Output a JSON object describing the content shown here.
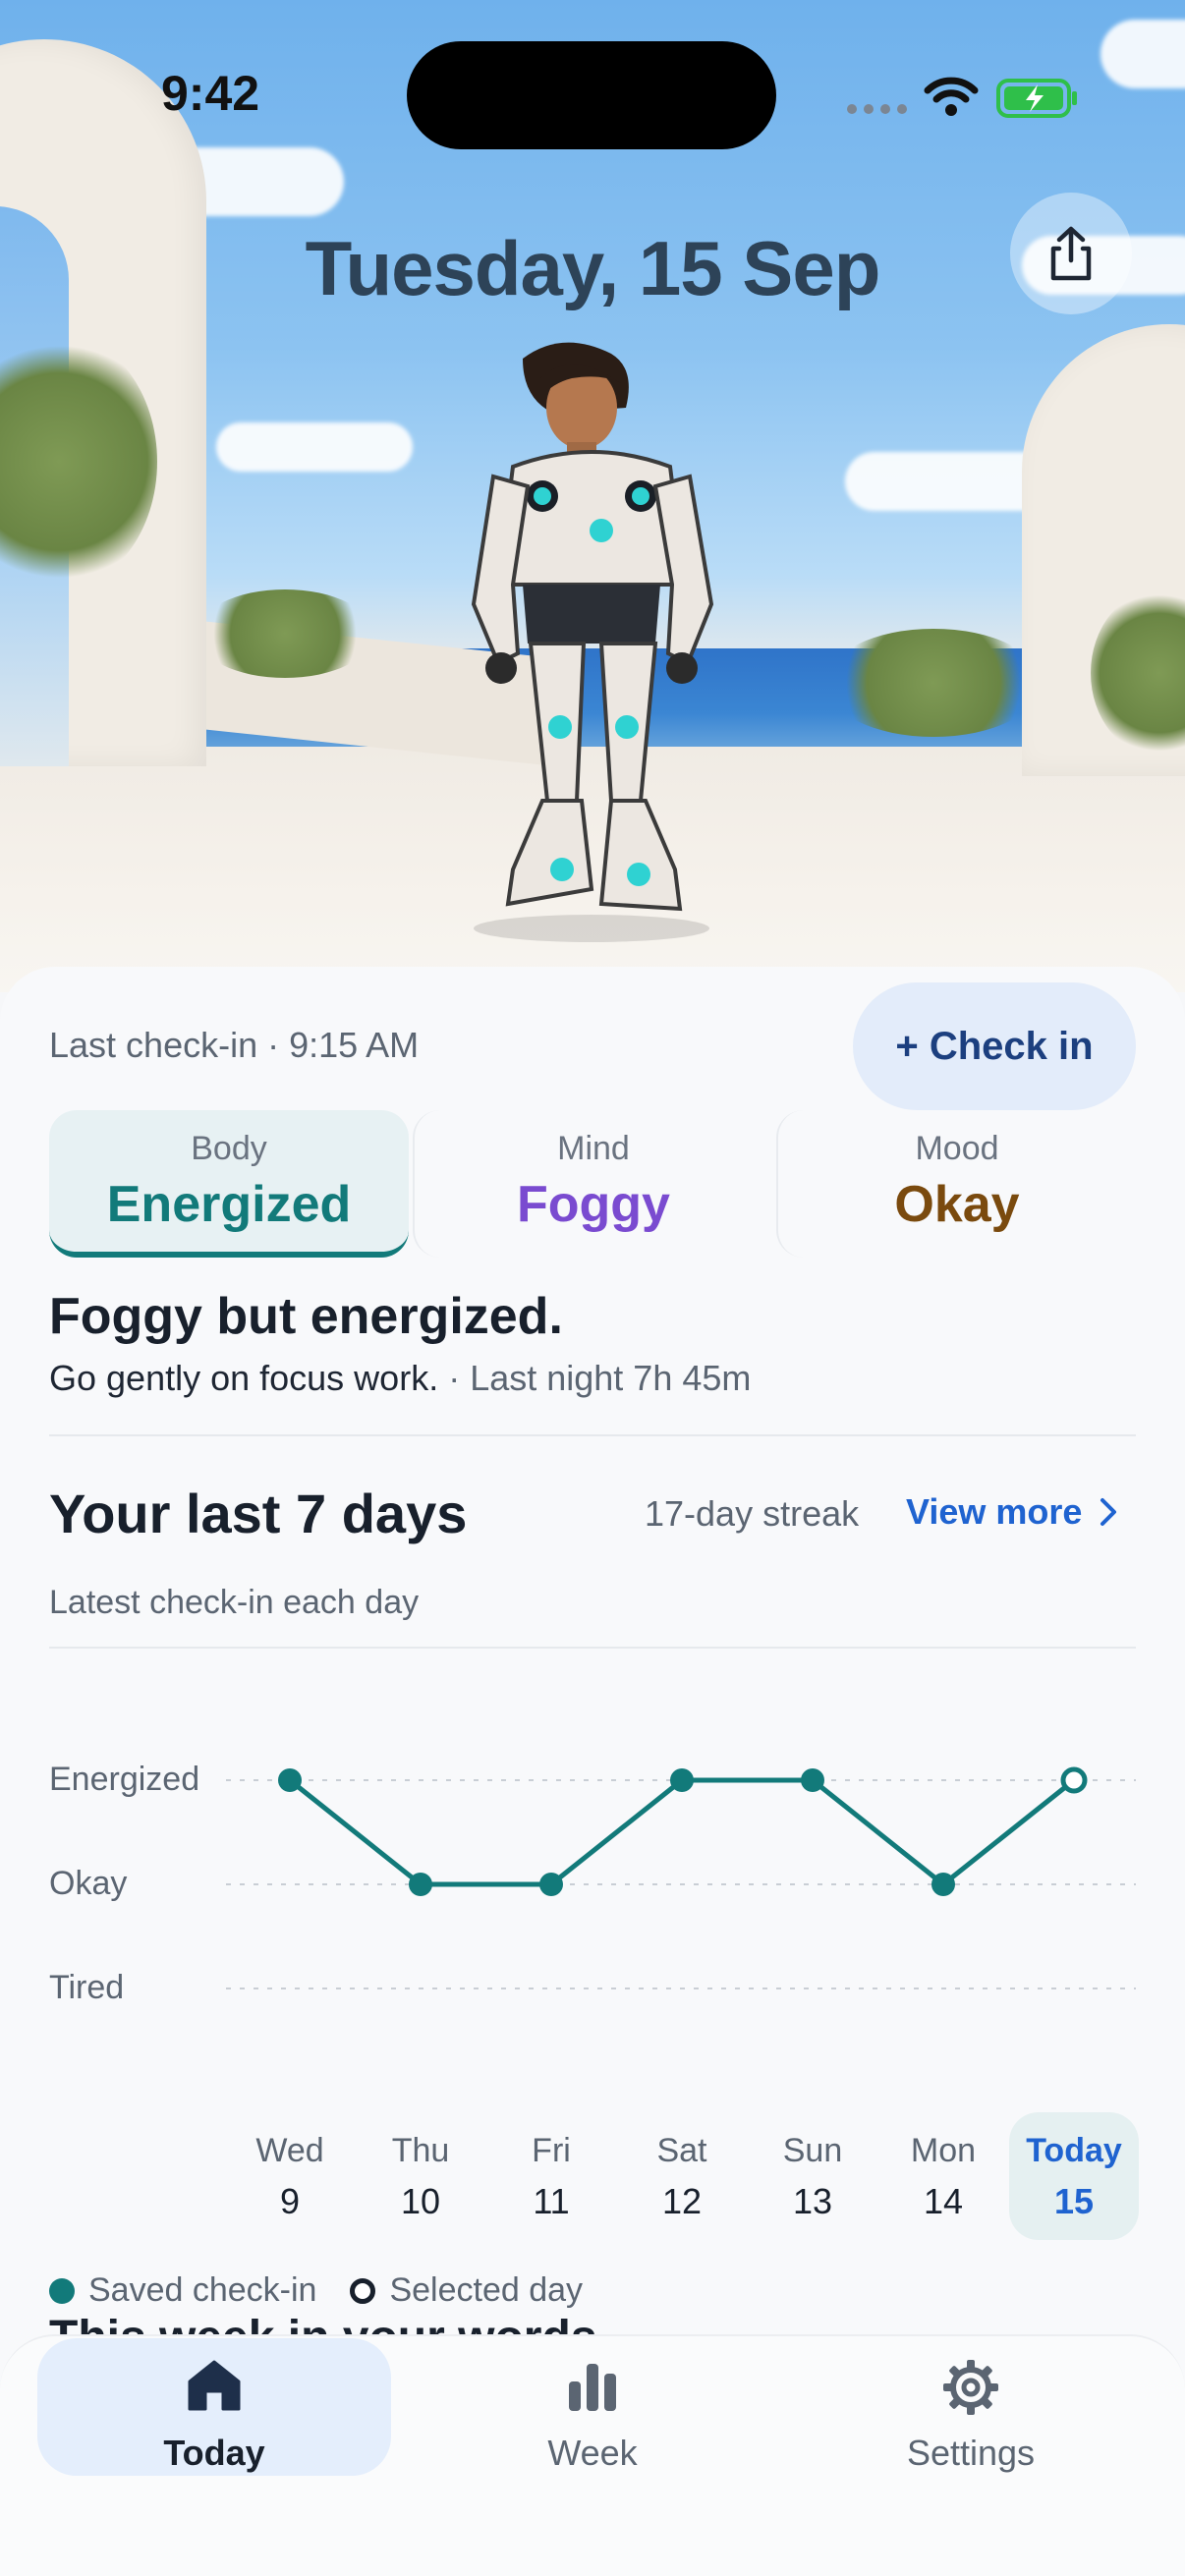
{
  "status_bar": {
    "time": "9:42"
  },
  "header": {
    "date": "Tuesday, 15 Sep"
  },
  "checkin": {
    "last": "Last check-in · 9:15 AM",
    "button_label": "+ Check in"
  },
  "cards": [
    {
      "label": "Body",
      "value": "Energized"
    },
    {
      "label": "Mind",
      "value": "Foggy"
    },
    {
      "label": "Mood",
      "value": "Okay"
    }
  ],
  "summary": {
    "title": "Foggy but energized.",
    "advice": "Go gently on focus work.",
    "sleep": " · Last night 7h 45m"
  },
  "history": {
    "title": "Your last 7 days",
    "streak": "17-day streak",
    "view_more": "View more",
    "subtitle": "Latest check-in each day",
    "levels": [
      "Energized",
      "Okay",
      "Tired"
    ],
    "days": [
      {
        "name": "Wed",
        "date": "9"
      },
      {
        "name": "Thu",
        "date": "10"
      },
      {
        "name": "Fri",
        "date": "11"
      },
      {
        "name": "Sat",
        "date": "12"
      },
      {
        "name": "Sun",
        "date": "13"
      },
      {
        "name": "Mon",
        "date": "14"
      },
      {
        "name": "Today",
        "date": "15"
      }
    ],
    "legend": {
      "saved": "Saved check-in",
      "selected": "Selected day"
    },
    "peek_text": "This week in your words"
  },
  "chart_data": {
    "type": "line",
    "x": [
      "Wed 9",
      "Thu 10",
      "Fri 11",
      "Sat 12",
      "Sun 13",
      "Mon 14",
      "Today 15"
    ],
    "y_categories": [
      "Tired",
      "Okay",
      "Energized"
    ],
    "series": [
      {
        "values": [
          "Energized",
          "Okay",
          "Okay",
          "Energized",
          "Energized",
          "Okay",
          "Energized"
        ]
      }
    ],
    "selected_index": 6,
    "color": "#127a7a",
    "grid": true
  },
  "tabs": [
    {
      "label": "Today",
      "icon": "home-icon"
    },
    {
      "label": "Week",
      "icon": "bar-chart-icon"
    },
    {
      "label": "Settings",
      "icon": "gear-icon"
    }
  ],
  "colors": {
    "accent": "#127a7a",
    "link": "#1f63d0",
    "mind": "#7a4bd0",
    "mood": "#7a4a0e"
  }
}
